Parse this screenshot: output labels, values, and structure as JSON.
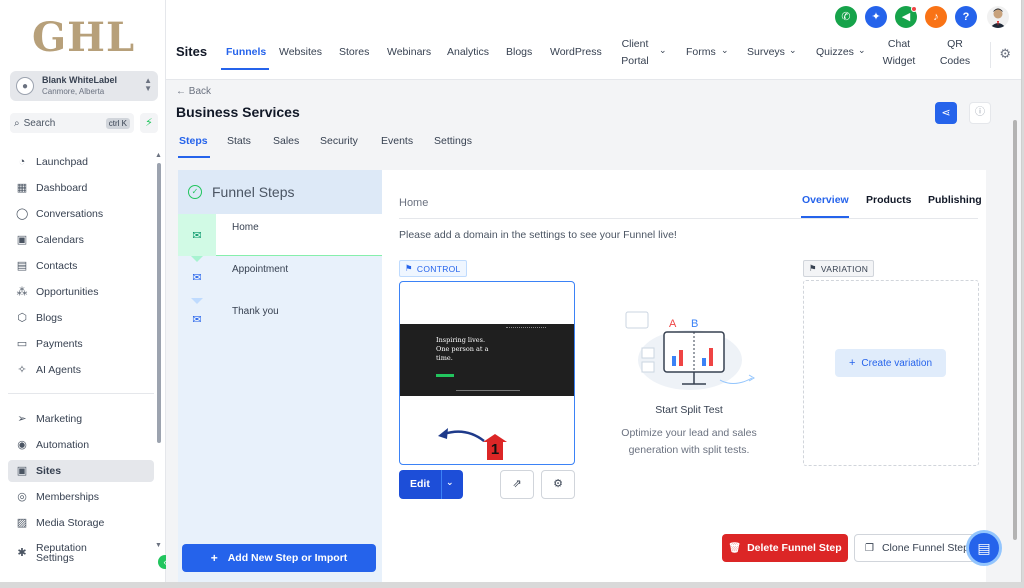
{
  "app": {
    "logo": "GHL",
    "account": {
      "name": "Blank WhiteLabel",
      "location": "Canmore, Alberta"
    },
    "search": {
      "placeholder": "Search",
      "shortcut": "ctrl K"
    }
  },
  "sidebar": {
    "items": [
      {
        "label": "Launchpad",
        "icon": "rocket-icon",
        "glyph": "◔"
      },
      {
        "label": "Dashboard",
        "icon": "dashboard-icon",
        "glyph": "▦"
      },
      {
        "label": "Conversations",
        "icon": "chat-icon",
        "glyph": "◯"
      },
      {
        "label": "Calendars",
        "icon": "calendar-icon",
        "glyph": "▣"
      },
      {
        "label": "Contacts",
        "icon": "contacts-icon",
        "glyph": "▤"
      },
      {
        "label": "Opportunities",
        "icon": "opportunities-icon",
        "glyph": "⁂"
      },
      {
        "label": "Blogs",
        "icon": "blog-icon",
        "glyph": "⬡"
      },
      {
        "label": "Payments",
        "icon": "payments-icon",
        "glyph": "▭"
      },
      {
        "label": "AI Agents",
        "icon": "ai-icon",
        "glyph": "✧"
      },
      {
        "label": "Marketing",
        "icon": "send-icon",
        "glyph": "➢"
      },
      {
        "label": "Automation",
        "icon": "automation-icon",
        "glyph": "◉"
      },
      {
        "label": "Sites",
        "icon": "sites-icon",
        "glyph": "▣"
      },
      {
        "label": "Memberships",
        "icon": "memberships-icon",
        "glyph": "◎"
      },
      {
        "label": "Media Storage",
        "icon": "media-icon",
        "glyph": "▨"
      },
      {
        "label": "Reputation Settings",
        "icon": "settings-icon",
        "glyph": "✱"
      }
    ],
    "active": "Sites"
  },
  "topbar": {
    "section": "Sites",
    "tabs": [
      "Funnels",
      "Websites",
      "Stores",
      "Webinars",
      "Analytics",
      "Blogs",
      "WordPress",
      "Client Portal",
      "Forms",
      "Surveys",
      "Quizzes",
      "Chat Widget",
      "QR Codes"
    ],
    "active_tab": "Funnels",
    "action_colors": {
      "phone": "#16a34a",
      "magic": "#2563eb",
      "megaphone": "#16a34a",
      "bell": "#f97316",
      "help": "#2563eb"
    }
  },
  "page": {
    "back": "Back",
    "title": "Business Services",
    "subtabs": [
      "Steps",
      "Stats",
      "Sales",
      "Security",
      "Events",
      "Settings"
    ],
    "active_subtab": "Steps"
  },
  "funnel": {
    "header": "Funnel Steps",
    "steps": [
      "Home",
      "Appointment",
      "Thank you"
    ],
    "active_step": "Home",
    "add_button": "Add New Step or Import"
  },
  "step_detail": {
    "title": "Home",
    "tabs": [
      "Overview",
      "Products",
      "Publishing"
    ],
    "active_tab": "Overview",
    "notice": "Please add a domain in the settings to see your Funnel live!",
    "control_tag": "CONTROL",
    "variation_tag": "VARIATION",
    "preview_heading": "Inspiring lives. One person at a time.",
    "edit_label": "Edit",
    "annotation_number": "1",
    "split_test": {
      "title": "Start Split Test",
      "description": "Optimize your lead and sales generation with split tests.",
      "label_a": "A",
      "label_b": "B"
    },
    "create_variation": "Create variation",
    "delete_button": "Delete Funnel Step",
    "clone_button": "Clone Funnel Step"
  }
}
